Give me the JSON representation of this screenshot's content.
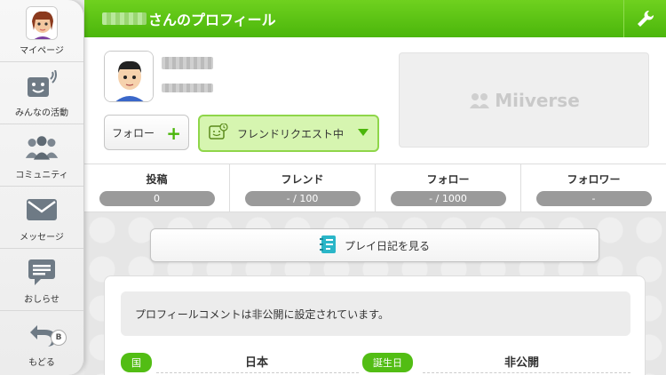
{
  "sidebar": {
    "items": [
      {
        "label": "マイページ",
        "icon": "mii-avatar-icon"
      },
      {
        "label": "みんなの活動",
        "icon": "activity-feed-icon"
      },
      {
        "label": "コミュニティ",
        "icon": "community-icon"
      },
      {
        "label": "メッセージ",
        "icon": "envelope-icon"
      },
      {
        "label": "おしらせ",
        "icon": "notifications-icon"
      },
      {
        "label": "もどる",
        "icon": "back-arrow-icon",
        "button_hint": "B"
      }
    ]
  },
  "header": {
    "title_suffix": "さんのプロフィール",
    "settings_icon": "wrench-icon",
    "color": "#52bd14"
  },
  "profile": {
    "follow_label": "フォロー",
    "friend_request_label": "フレンドリクエスト中",
    "miiverse_logo_text": "Miiverse"
  },
  "stats": [
    {
      "label": "投稿",
      "value": "0"
    },
    {
      "label": "フレンド",
      "value": "- / 100"
    },
    {
      "label": "フォロー",
      "value": "- / 1000"
    },
    {
      "label": "フォロワー",
      "value": "-"
    }
  ],
  "content": {
    "play_diary_label": "プレイ日記を見る",
    "profile_comment": "プロフィールコメントは非公開に設定されています。",
    "country_tag": "国",
    "country_value": "日本",
    "birthday_tag": "誕生日",
    "birthday_value": "非公開"
  }
}
